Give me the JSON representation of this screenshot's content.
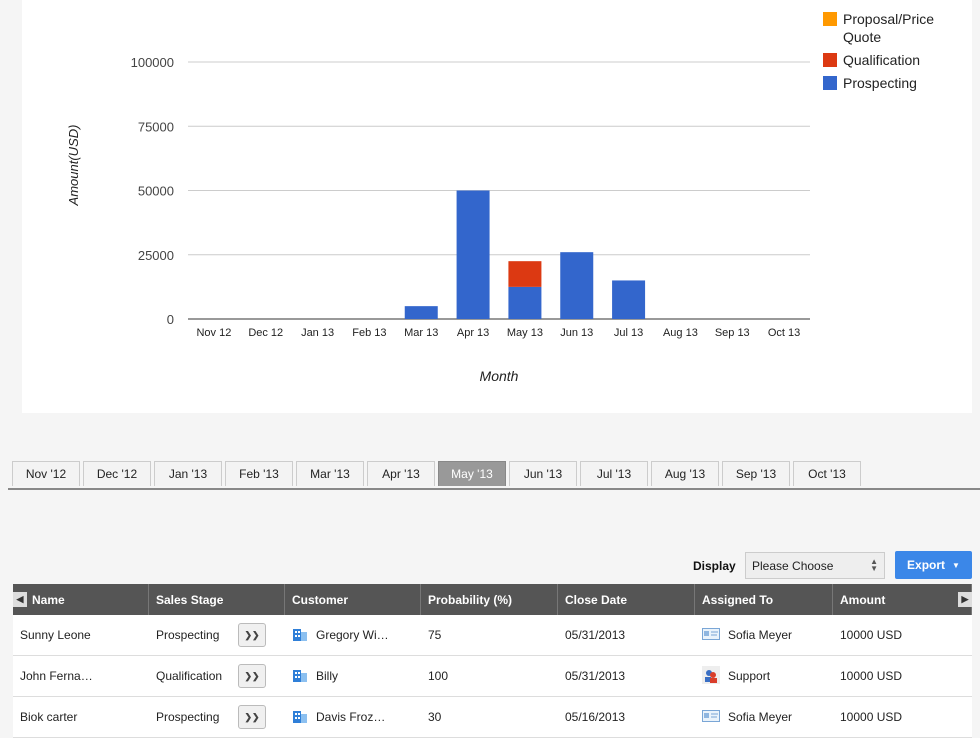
{
  "chart_data": {
    "type": "bar",
    "stacked": true,
    "categories": [
      "Nov 12",
      "Dec 12",
      "Jan 13",
      "Feb 13",
      "Mar 13",
      "Apr 13",
      "May 13",
      "Jun 13",
      "Jul 13",
      "Aug 13",
      "Sep 13",
      "Oct 13"
    ],
    "series": [
      {
        "name": "Proposal/Price Quote",
        "color": "#ff9900",
        "values": [
          0,
          0,
          0,
          0,
          0,
          0,
          0,
          0,
          0,
          0,
          0,
          0
        ]
      },
      {
        "name": "Qualification",
        "color": "#dc3912",
        "values": [
          0,
          0,
          0,
          0,
          0,
          0,
          10000,
          0,
          0,
          0,
          0,
          0
        ]
      },
      {
        "name": "Prospecting",
        "color": "#3366cc",
        "values": [
          0,
          0,
          0,
          0,
          5000,
          50000,
          12500,
          26000,
          15000,
          0,
          0,
          0
        ]
      }
    ],
    "legend_order": [
      "Proposal/Price Quote",
      "Qualification",
      "Prospecting"
    ],
    "yticks": [
      "0",
      "25000",
      "50000",
      "75000",
      "100000"
    ],
    "ylim": [
      0,
      100000
    ],
    "xlabel": "Month",
    "ylabel": "Amount(USD)",
    "grid": true,
    "legend_position": "right"
  },
  "month_tabs": [
    {
      "label": "Nov '12",
      "active": false
    },
    {
      "label": "Dec '12",
      "active": false
    },
    {
      "label": "Jan '13",
      "active": false
    },
    {
      "label": "Feb '13",
      "active": false
    },
    {
      "label": "Mar '13",
      "active": false
    },
    {
      "label": "Apr '13",
      "active": false
    },
    {
      "label": "May '13",
      "active": true
    },
    {
      "label": "Jun '13",
      "active": false
    },
    {
      "label": "Jul '13",
      "active": false
    },
    {
      "label": "Aug '13",
      "active": false
    },
    {
      "label": "Sep '13",
      "active": false
    },
    {
      "label": "Oct '13",
      "active": false
    }
  ],
  "toolbar": {
    "display_label": "Display",
    "display_value": "Please Choose",
    "export_label": "Export"
  },
  "table": {
    "columns": [
      "Name",
      "Sales Stage",
      "Customer",
      "Probability (%)",
      "Close Date",
      "Assigned To",
      "Amount"
    ],
    "rows": [
      {
        "name": "Sunny Leone",
        "stage": "Prospecting",
        "customer": "Gregory Wi…",
        "probability": "75",
        "close_date": "05/31/2013",
        "assigned_to": "Sofia Meyer",
        "assigned_icon": "contact-card-icon",
        "amount": "10000 USD"
      },
      {
        "name": "John Ferna…",
        "stage": "Qualification",
        "customer": "Billy",
        "probability": "100",
        "close_date": "05/31/2013",
        "assigned_to": "Support",
        "assigned_icon": "user-group-icon",
        "amount": "10000 USD"
      },
      {
        "name": "Biok carter",
        "stage": "Prospecting",
        "customer": "Davis Froz…",
        "probability": "30",
        "close_date": "05/16/2013",
        "assigned_to": "Sofia Meyer",
        "assigned_icon": "contact-card-icon",
        "amount": "10000 USD"
      }
    ]
  }
}
